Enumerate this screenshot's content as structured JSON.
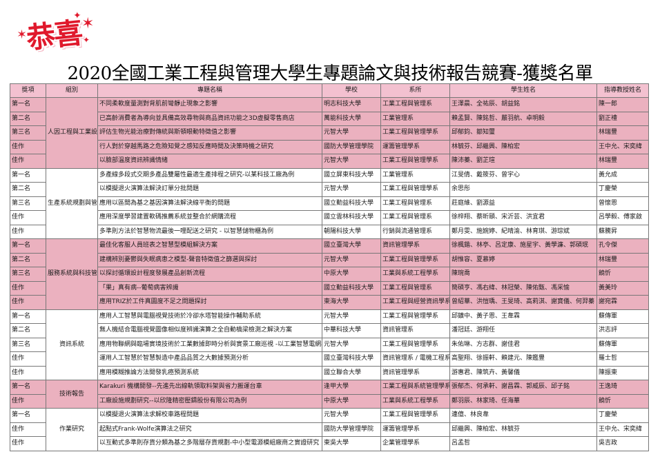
{
  "header": {
    "logo_text": "恭喜",
    "title": "2020全國工業工程與管理大學生專題論文與技術報告競賽-獲獎名單"
  },
  "columns": [
    "獎項",
    "組別",
    "專題名稱",
    "學校",
    "系所",
    "學生姓名",
    "指導教授姓名"
  ],
  "groups": [
    {
      "name": "人因工程與工業設計",
      "rows": [
        {
          "award": "第一名",
          "topic": "不同柔軟度量測對背肌前彎靜止現象之影響",
          "school": "明志科技大學",
          "dept": "工業工程與管理系",
          "students": "王澤晨、全祐辰、胡益銘",
          "advisor": "陳一郎"
        },
        {
          "award": "第二名",
          "topic": "已高齡消費者為導向並具備高效尋物與商品資訊功能之3D虛擬零售商店",
          "school": "萬能科技大學",
          "dept": "工業管理系",
          "students": "賴孟賢、陳銘哲、嚴羽航、卓明毅",
          "advisor": "劉正禮"
        },
        {
          "award": "第三名",
          "topic": "評估生物光能治療對傳統與斯頓眼動特徵值之影響",
          "school": "元智大學",
          "dept": "工業工程與管理學系",
          "students": "邱郁鈞、鄒知璽",
          "advisor": "林瑞豐"
        },
        {
          "award": "佳作",
          "topic": "行人對於穿越馬路之危險知覺之感知反應時間及決策時機之研究",
          "school": "國防大學管理學院",
          "dept": "運籌管理學系",
          "students": "林毓芬、邱繼興、陳柏宏",
          "advisor": "王中允、宋奕緯"
        },
        {
          "award": "佳作",
          "topic": "以臉部溫度資訊辨識情緒",
          "school": "元智大學",
          "dept": "工業工程與管理學系",
          "students": "陳沛蓁、劉芷瑄",
          "advisor": "林瑞豐"
        }
      ]
    },
    {
      "name": "生產系統規劃與管制",
      "rows": [
        {
          "award": "第一名",
          "topic": "多產線多段式交期多產品雙屬性最適生產排程之研究-以某科技工廠為例",
          "school": "國立屏東科技大學",
          "dept": "工業管理系",
          "students": "江旻倩、戴筱芬、曾宇心",
          "advisor": "黃允成"
        },
        {
          "award": "第二名",
          "topic": "以模擬退火演算法解決訂單分批問題",
          "school": "元智大學",
          "dept": "工業工程與管理學系",
          "students": "余思彤",
          "advisor": "丁慶榮"
        },
        {
          "award": "第三名",
          "topic": "應用以區間為基之基因演算法解決線平衡的問題",
          "school": "國立勤益科技大學",
          "dept": "工業工程與管理系",
          "students": "莊庭維、劉源益",
          "advisor": "曾懷恩"
        },
        {
          "award": "佳作",
          "topic": "應用深度學習建置軟碼推薦系統並整合於網購流程",
          "school": "國立雲林科技大學",
          "dept": "工業工程與管理系",
          "students": "徐梓翔、蔡昕頤、宋沂芸、洪宜君",
          "advisor": "呂學毅、傅家啟"
        },
        {
          "award": "佳作",
          "topic": "多準則方法於智慧物流最後一哩配送之研究 - 以智慧儲物櫃為例",
          "school": "朝陽科技大學",
          "dept": "行銷與流通管理系",
          "students": "鄭月雯、施婉婷、紀晴渝、林育琪、游琮斌",
          "advisor": "蘇騰昇"
        }
      ]
    },
    {
      "name": "服務系統與科技管理",
      "rows": [
        {
          "award": "第一名",
          "topic": "最佳化客服人員班表之智慧型模組解決方案",
          "school": "國立臺灣大學",
          "dept": "資訊管理學系",
          "students": "徐楓鍇、林亭、呂定康、施星宇、黃學濂、郭碩珉",
          "advisor": "孔令傑"
        },
        {
          "award": "第二名",
          "topic": "建構辨別憂鬱與失眠病患之模型-聲音特徵值之篩選與探討",
          "school": "元智大學",
          "dept": "工業工程與管理學系",
          "students": "胡惟容、夏慕婷",
          "advisor": "林瑞豐"
        },
        {
          "award": "第三名",
          "topic": "以探討循環設計程度發展產品創新流程",
          "school": "中原大學",
          "dept": "工業與系統工程學系",
          "students": "陳琬喬",
          "advisor": "饒忻"
        },
        {
          "award": "佳作",
          "topic": "「果」真有病--葡萄病害辨識",
          "school": "國立勤益科技大學",
          "dept": "工業工程與管理系",
          "students": "簡碩亨、馮右緯、林冠榮、陳佑甄、馮采愉",
          "advisor": "黃美玲"
        },
        {
          "award": "佳作",
          "topic": "應用TRIZ於工件真圓度不足之問題探討",
          "school": "東海大學",
          "dept": "工業工程與經營資訊學系",
          "students": "曾紹華、洪愷瑀、王旻琦、高莉淇、謝寶儀、何羿蓁",
          "advisor": "謝宛霖"
        }
      ]
    },
    {
      "name": "資訊系統",
      "rows": [
        {
          "award": "第一名",
          "topic": "應用人工智慧與電腦視覺技術於冷卻水塔智能操作輔助系統",
          "school": "元智大學",
          "dept": "工業工程與管理學系",
          "students": "邱鑛中、黃子恩、王韋霖",
          "advisor": "蘇傳軍"
        },
        {
          "award": "第二名",
          "topic": "無人機結合電腦視覺圖像相似度辨識演算之全自動橋梁檢測之解決方案",
          "school": "中華科技大學",
          "dept": "資訊管理系",
          "students": "潘冠廷、游翔任",
          "advisor": "洪志評"
        },
        {
          "award": "第三名",
          "topic": "應用物聯網與臨場實境技術於工業數據即時分析與實景工廠巡視 -以工業智慧電網為",
          "school": "元智大學",
          "dept": "工業工程與管理學系",
          "students": "朱佑琳、方志群、謝佳君",
          "advisor": "蘇傳軍"
        },
        {
          "award": "佳作",
          "topic": "運用人工智慧於智慧製造中產品品質之大數據預測分析",
          "school": "國立臺灣科技大學",
          "dept": "資訊管理系 / 電機工程系",
          "students": "高聖翔、徐振軒、賴建元、陳鑑豐",
          "advisor": "羅士哲"
        },
        {
          "award": "佳作",
          "topic": "應用模糊推論方法開發乳癌預測系統",
          "school": "國立聯合大學",
          "dept": "資訊管理學系",
          "students": "游惠君、陳筑卉、黃馨儀",
          "advisor": "陳振東"
        }
      ]
    },
    {
      "name": "技術報告",
      "rows": [
        {
          "award": "第一名",
          "topic": "Karakuri 機構開發--先進先出線軌領取料架與省力搬運台車",
          "school": "逢甲大學",
          "dept": "工業工程與系統管理學系",
          "students": "張郁杰、何承軒、謝昌霖、郭威辰、邱子銘",
          "advisor": "王逸琦"
        },
        {
          "award": "佳作",
          "topic": "工廠設施規劃研究--以欣隆精密壓鑄股份有限公司為例",
          "school": "中原大學",
          "dept": "工業與系統工程學系",
          "students": "鄭羽辰、林家琦、任海華",
          "advisor": "饒忻"
        }
      ]
    },
    {
      "name": "作業研究",
      "rows": [
        {
          "award": "第一名",
          "topic": "以模擬退火演算法求解校車路程問題",
          "school": "元智大學",
          "dept": "工業工程與管理學系",
          "students": "連億、林良韋",
          "advisor": "丁慶榮"
        },
        {
          "award": "佳作",
          "topic": "起點式Frank-Wolfe演算法之研究",
          "school": "國防大學管理學院",
          "dept": "運籌管理學系",
          "students": "邱繼興、陳柏宏、林毓芬",
          "advisor": "王中允、宋奕緯"
        },
        {
          "award": "佳作",
          "topic": "以互動式多準則存貨分類為基之多階層存貨規劃-中小型電源模組廠商之實證研究",
          "school": "東吳大學",
          "dept": "企業管理學系",
          "students": "呂孟哲",
          "advisor": "吳吉政"
        }
      ]
    }
  ],
  "colors": {
    "pink_row": "#ebb1bf",
    "header_pink": "#f3c1d0",
    "logo_red": "#e0192c"
  }
}
